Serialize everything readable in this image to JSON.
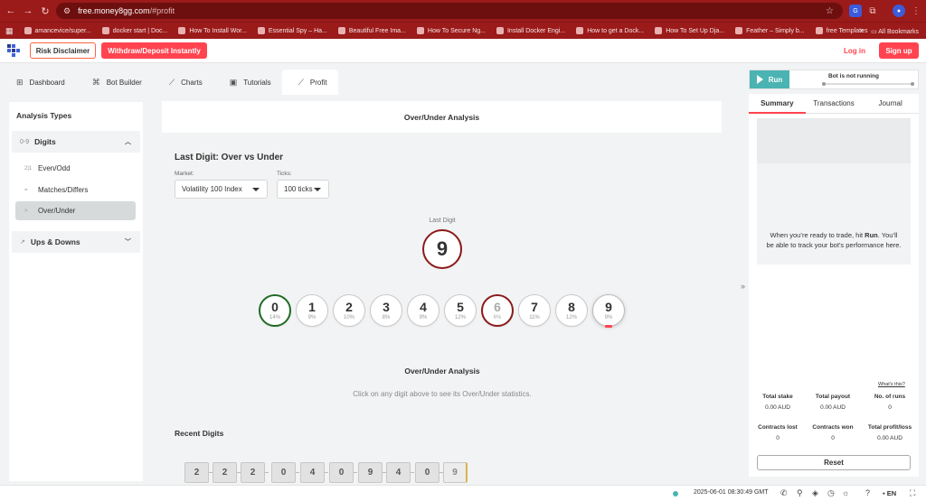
{
  "browser": {
    "url_host": "free.money8gg.com",
    "url_path": "/#profit",
    "bookmarks": [
      "amancevice/super...",
      "docker start | Doc...",
      "How To Install Wor...",
      "Essential Spy – Ha...",
      "Beautiful Free Ima...",
      "How To Secure Ng...",
      "Install Docker Engi...",
      "How to get a Dock...",
      "How To Set Up Dja...",
      "Feather – Simply b...",
      "free Templates"
    ],
    "bookmarks_more": "»",
    "all_bookmarks": "All Bookmarks"
  },
  "header": {
    "risk_disclaimer": "Risk Disclaimer",
    "withdraw_deposit": "Withdraw/Deposit Instantly",
    "login": "Log in",
    "signup": "Sign up"
  },
  "tabs": [
    {
      "label": "Dashboard",
      "icon": "dashboard-icon"
    },
    {
      "label": "Bot Builder",
      "icon": "puzzle-icon"
    },
    {
      "label": "Charts",
      "icon": "chart-icon"
    },
    {
      "label": "Tutorials",
      "icon": "tutorial-icon"
    },
    {
      "label": "Profit",
      "icon": "trend-icon",
      "active": true
    }
  ],
  "sidebar": {
    "title": "Analysis Types",
    "digits": {
      "prefix": "0-9",
      "label": "Digits"
    },
    "items": [
      {
        "prefix": "2|1",
        "label": "Even/Odd"
      },
      {
        "prefix": "=",
        "label": "Matches/Differs"
      },
      {
        "prefix": ">",
        "label": "Over/Under",
        "active": true
      }
    ],
    "ups_downs": {
      "label": "Ups & Downs"
    }
  },
  "main": {
    "header_title": "Over/Under Analysis",
    "section_title": "Last Digit: Over vs Under",
    "market_label": "Market:",
    "market_value": "Volatility 100 Index",
    "ticks_label": "Ticks:",
    "ticks_value": "100 ticks",
    "last_digit_label": "Last Digit",
    "last_digit_value": "9",
    "digits": [
      {
        "digit": "0",
        "pct": "14%"
      },
      {
        "digit": "1",
        "pct": "9%"
      },
      {
        "digit": "2",
        "pct": "10%"
      },
      {
        "digit": "3",
        "pct": "8%"
      },
      {
        "digit": "4",
        "pct": "9%"
      },
      {
        "digit": "5",
        "pct": "12%"
      },
      {
        "digit": "6",
        "pct": "6%"
      },
      {
        "digit": "7",
        "pct": "11%"
      },
      {
        "digit": "8",
        "pct": "12%"
      },
      {
        "digit": "9",
        "pct": "9%"
      }
    ],
    "ou_title": "Over/Under Analysis",
    "ou_hint": "Click on any digit above to see its Over/Under statistics.",
    "recent_title": "Recent Digits",
    "recent_digits": [
      "2",
      "2",
      "2",
      "0",
      "4",
      "0",
      "9",
      "4",
      "0",
      "9"
    ]
  },
  "right": {
    "run_label": "Run",
    "status": "Bot is not running",
    "tabs": [
      "Summary",
      "Transactions",
      "Journal"
    ],
    "message_pre": "When you’re ready to trade, hit ",
    "message_bold": "Run",
    "message_post": ". You’ll be able to track your bot’s performance here.",
    "whats_this": "What's this?",
    "stats": [
      {
        "label": "Total stake",
        "value": "0.00 AUD"
      },
      {
        "label": "Total payout",
        "value": "0.00 AUD"
      },
      {
        "label": "No. of runs",
        "value": "0"
      },
      {
        "label": "Contracts lost",
        "value": "0"
      },
      {
        "label": "Contracts won",
        "value": "0"
      },
      {
        "label": "Total profit/loss",
        "value": "0.00 AUD"
      }
    ],
    "reset": "Reset"
  },
  "footer": {
    "timestamp": "2025-06-01 08:30:49 GMT",
    "language": "EN"
  },
  "colors": {
    "brand_red": "#ff444f",
    "browser_red": "#9b1a1a",
    "run_teal": "#4bb4b3"
  }
}
